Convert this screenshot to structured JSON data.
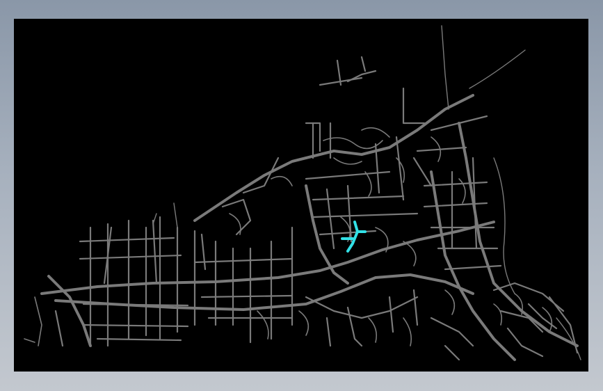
{
  "map": {
    "background_color": "#000000",
    "road_color": "#7a7a7a",
    "highlight_color": "#32e0e6",
    "frame_color": "#9aa5b3"
  }
}
